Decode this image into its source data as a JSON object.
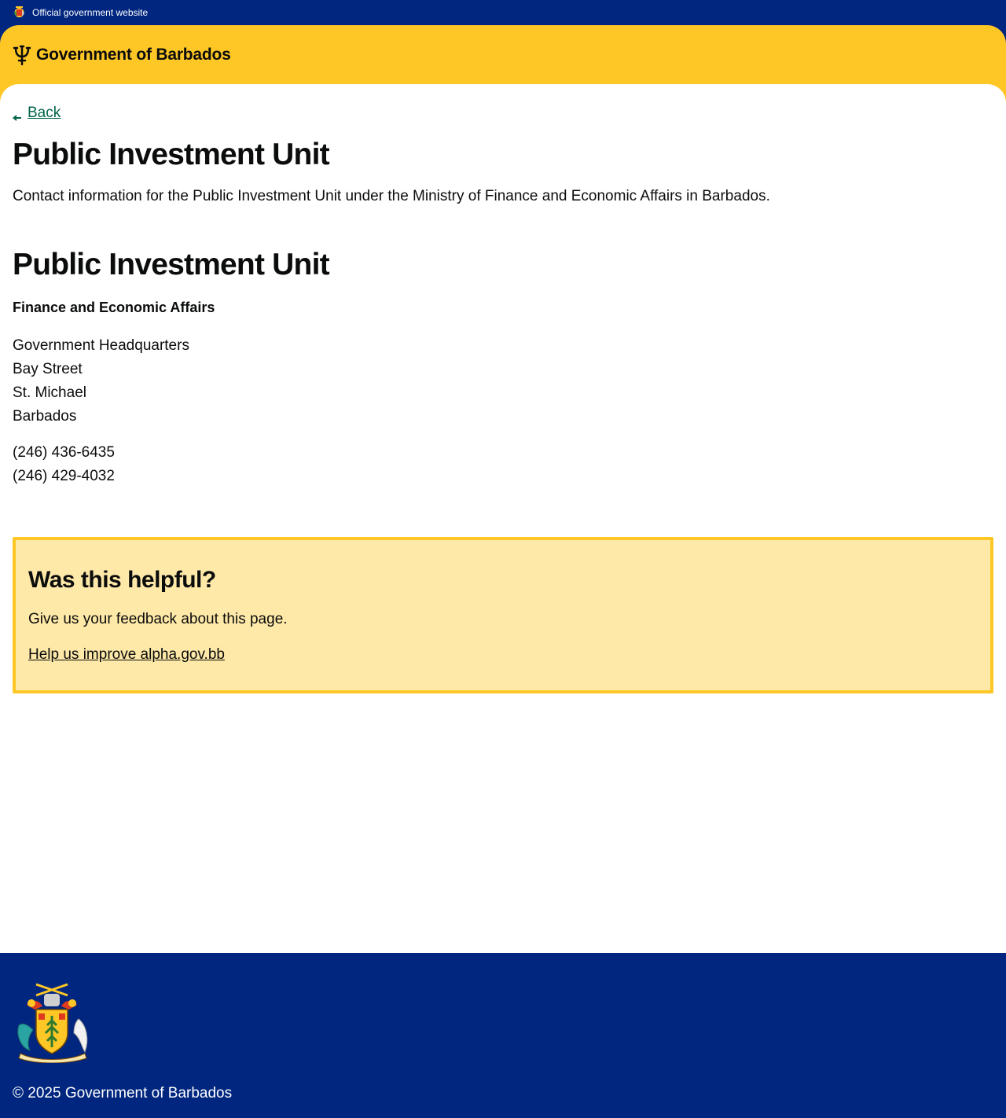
{
  "topbar": {
    "official_text": "Official government website"
  },
  "header": {
    "brand_text": "Government of Barbados"
  },
  "main": {
    "back_label": "Back",
    "page_title": "Public Investment Unit",
    "lede": "Contact information for the Public Investment Unit under the Ministry of Finance and Economic Affairs in Barbados.",
    "contact": {
      "title": "Public Investment Unit",
      "organisation": "Finance and Economic Affairs",
      "address_lines": [
        "Government Headquarters",
        "Bay Street",
        "St. Michael",
        "Barbados"
      ],
      "phones": [
        "(246) 436-6435",
        "(246) 429-4032"
      ]
    }
  },
  "feedback": {
    "title": "Was this helpful?",
    "text": "Give us your feedback about this page.",
    "link_label": "Help us improve alpha.gov.bb"
  },
  "footer": {
    "copyright": "© 2025 Government of Barbados"
  },
  "colors": {
    "navy": "#00267f",
    "gold": "#ffc726",
    "feedback_bg": "#ffe9a8",
    "link_green": "#00654a"
  },
  "icons": {
    "topbar_crest": "coat-of-arms-icon",
    "brand_mark": "trident-icon",
    "back": "arrow-left-icon",
    "footer_crest": "coat-of-arms-icon"
  }
}
